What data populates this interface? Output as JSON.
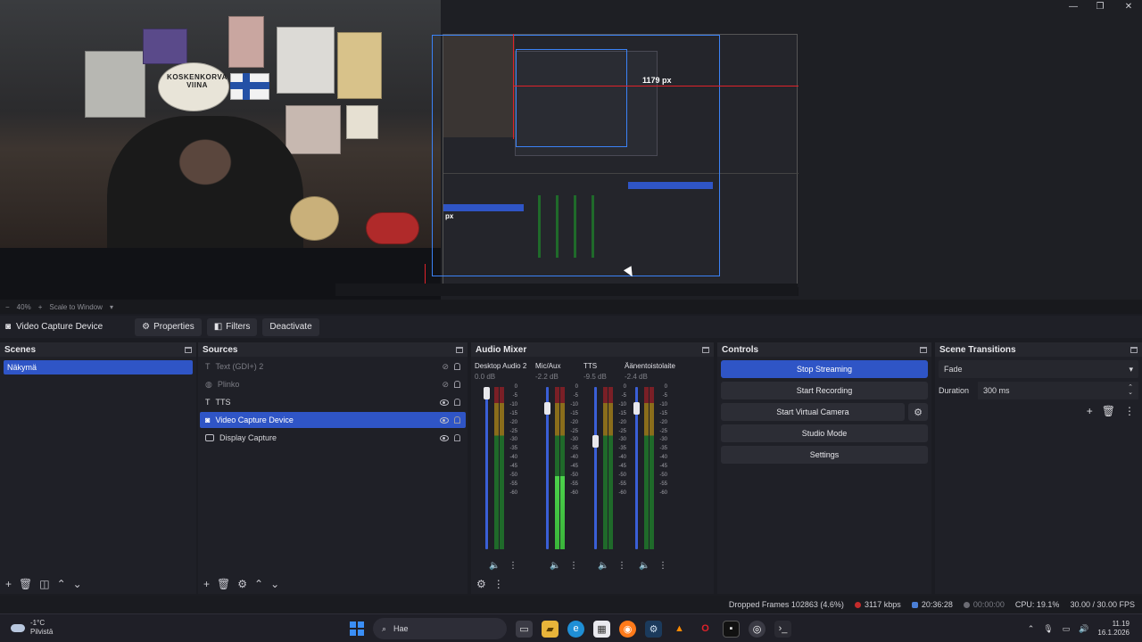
{
  "preview": {
    "px_label": "1179 px",
    "nested_px_label": "px",
    "logo_text": "KOSKENKORVA VIINA"
  },
  "zoombar": {
    "zoom": "40%",
    "mode": "Scale to Window"
  },
  "source_toolbar": {
    "selected_source": "Video Capture Device",
    "properties": "Properties",
    "filters": "Filters",
    "deactivate": "Deactivate"
  },
  "scenes": {
    "title": "Scenes",
    "items": [
      {
        "label": "Näkymä",
        "selected": true
      }
    ]
  },
  "sources": {
    "title": "Sources",
    "items": [
      {
        "label": "Text (GDI+) 2",
        "visible": false
      },
      {
        "label": "Plinko",
        "visible": false
      },
      {
        "label": "TTS",
        "visible": true
      },
      {
        "label": "Video Capture Device",
        "visible": true,
        "selected": true
      },
      {
        "label": "Display Capture",
        "visible": true
      }
    ]
  },
  "mixer": {
    "title": "Audio Mixer",
    "scale": [
      "0",
      "-5",
      "-10",
      "-15",
      "-20",
      "-25",
      "-30",
      "-35",
      "-40",
      "-45",
      "-50",
      "-55",
      "-60"
    ],
    "channels": [
      {
        "name": "Desktop Audio 2",
        "db": "0.0 dB",
        "fader": 1.0,
        "level": 0.0
      },
      {
        "name": "Mic/Aux",
        "db": "-2.2 dB",
        "fader": 0.9,
        "level": 0.45
      },
      {
        "name": "TTS",
        "db": "-9.5 dB",
        "fader": 0.68,
        "level": 0.0
      },
      {
        "name": "Äänentoistolaite",
        "db": "-2.4 dB",
        "fader": 0.9,
        "level": 0.0
      }
    ]
  },
  "controls": {
    "title": "Controls",
    "stop_streaming": "Stop Streaming",
    "start_recording": "Start Recording",
    "start_virtual_camera": "Start Virtual Camera",
    "studio_mode": "Studio Mode",
    "settings": "Settings"
  },
  "transitions": {
    "title": "Scene Transitions",
    "selected": "Fade",
    "duration_label": "Duration",
    "duration_value": "300 ms"
  },
  "status": {
    "dropped_frames": "Dropped Frames 102863 (4.6%)",
    "bitrate": "3117 kbps",
    "stream_time": "20:36:28",
    "record_time": "00:00:00",
    "cpu": "CPU: 19.1%",
    "fps": "30.00 / 30.00 FPS"
  },
  "taskbar": {
    "temperature": "-1°C",
    "weather": "Pilvistä",
    "search_placeholder": "Hae",
    "time": "11.19",
    "date": "16.1.2026"
  },
  "colors": {
    "accent": "#2f55c6",
    "record_red": "#e0222a",
    "live_blue": "#3b82f6"
  }
}
